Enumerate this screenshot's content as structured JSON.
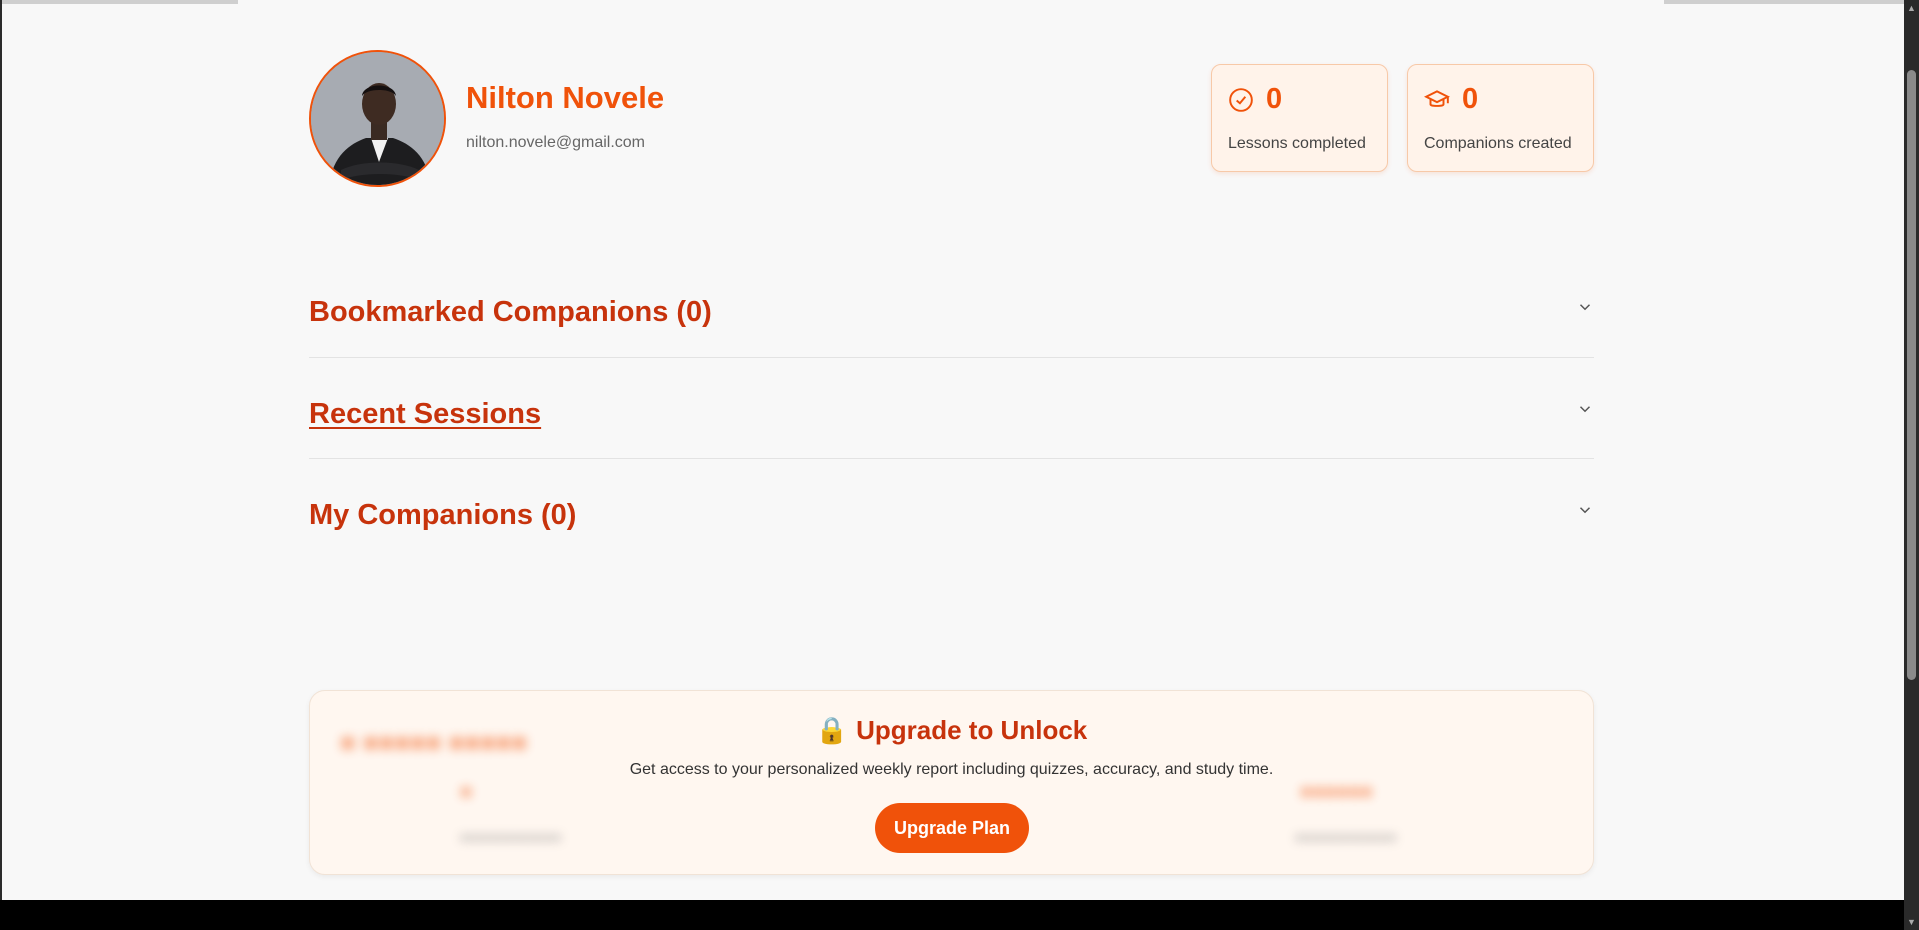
{
  "profile": {
    "name": "Nilton Novele",
    "email": "nilton.novele@gmail.com"
  },
  "stats": {
    "lessons": {
      "value": "0",
      "label": "Lessons completed",
      "icon": "check-circle-icon"
    },
    "companions": {
      "value": "0",
      "label": "Companions created",
      "icon": "graduation-cap-icon"
    }
  },
  "sections": {
    "bookmarked": "Bookmarked Companions (0)",
    "recent": "Recent Sessions",
    "my_companions": "My Companions (0)"
  },
  "upgrade": {
    "lock_icon": "🔒",
    "heading": "Upgrade to Unlock",
    "text": "Get access to your personalized weekly report including quizzes, accuracy, and study time.",
    "button": "Upgrade Plan"
  },
  "colors": {
    "accent": "#f0520a",
    "heading": "#c7330c",
    "card_bg": "#fff3ea"
  }
}
